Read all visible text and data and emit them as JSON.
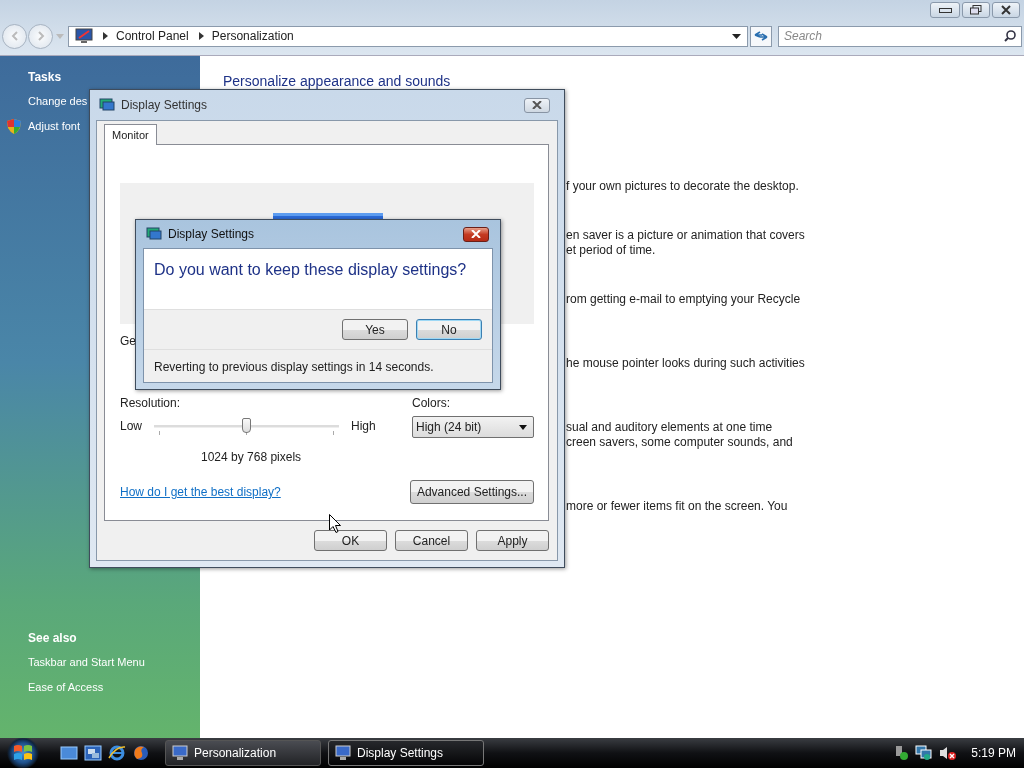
{
  "window": {
    "breadcrumb": [
      "Control Panel",
      "Personalization"
    ],
    "search": {
      "placeholder": "Search"
    }
  },
  "sidebar": {
    "tasks_heading": "Tasks",
    "tasks": [
      {
        "label": "Change des",
        "shield": false
      },
      {
        "label": "Adjust font",
        "shield": true
      }
    ],
    "see_also_heading": "See also",
    "see_also": [
      "Taskbar and Start Menu",
      "Ease of Access"
    ]
  },
  "main": {
    "heading": "Personalize appearance and sounds",
    "descriptions": [
      [
        "f your own pictures to decorate the desktop."
      ],
      [
        "en saver is a picture or animation that covers",
        "et period of time."
      ],
      [
        "rom getting e-mail to emptying your Recycle"
      ],
      [
        "he mouse pointer looks during such activities"
      ],
      [
        "sual and auditory elements at one time",
        "creen savers, some computer sounds, and"
      ],
      [
        "more or fewer items fit on the screen. You"
      ]
    ]
  },
  "display_settings": {
    "title": "Display Settings",
    "tabs": [
      {
        "label": "Monitor",
        "selected": true
      }
    ],
    "general_label": "Ge",
    "resolution_label": "Resolution:",
    "low": "Low",
    "high": "High",
    "resolution": {
      "level": 0.5
    },
    "resolution_reading": "1024 by 768 pixels",
    "colors_label": "Colors:",
    "colors_value": "High (24 bit)",
    "help_link": "How do I get the best display?",
    "advanced_button": "Advanced Settings...",
    "buttons": [
      "OK",
      "Cancel",
      "Apply"
    ]
  },
  "confirm": {
    "title": "Display Settings",
    "question": "Do you want to keep these display settings?",
    "buttons": [
      {
        "label": "Yes",
        "focused": false
      },
      {
        "label": "No",
        "focused": true
      }
    ],
    "countdown": "Reverting to previous display settings in 14 seconds."
  },
  "taskbar": {
    "tasks": [
      {
        "label": "Personalization",
        "selected": false
      },
      {
        "label": "Display Settings",
        "selected": true
      }
    ],
    "clock": "5:19 PM"
  }
}
